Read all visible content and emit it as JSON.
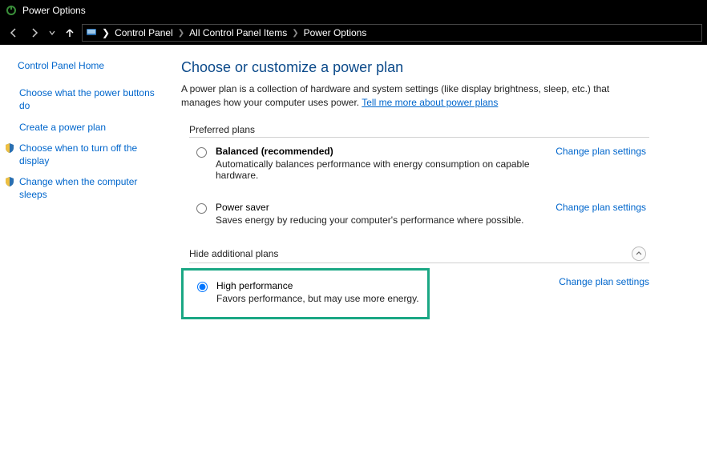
{
  "window": {
    "title": "Power Options"
  },
  "breadcrumbs": {
    "root": "Control Panel",
    "mid": "All Control Panel Items",
    "leaf": "Power Options"
  },
  "sidebar": {
    "home": "Control Panel Home",
    "links": {
      "buttons": "Choose what the power buttons do",
      "create": "Create a power plan",
      "turnoff": "Choose when to turn off the display",
      "sleeps": "Change when the computer sleeps"
    }
  },
  "main": {
    "title": "Choose or customize a power plan",
    "desc": "A power plan is a collection of hardware and system settings (like display brightness, sleep, etc.) that manages how your computer uses power. ",
    "desc_link": "Tell me more about power plans",
    "preferred_label": "Preferred plans",
    "hide_label": "Hide additional plans",
    "change_link": "Change plan settings",
    "plans": {
      "balanced": {
        "name": "Balanced (recommended)",
        "desc": "Automatically balances performance with energy consumption on capable hardware."
      },
      "saver": {
        "name": "Power saver",
        "desc": "Saves energy by reducing your computer's performance where possible."
      },
      "high": {
        "name": "High performance",
        "desc": "Favors performance, but may use more energy."
      }
    }
  }
}
